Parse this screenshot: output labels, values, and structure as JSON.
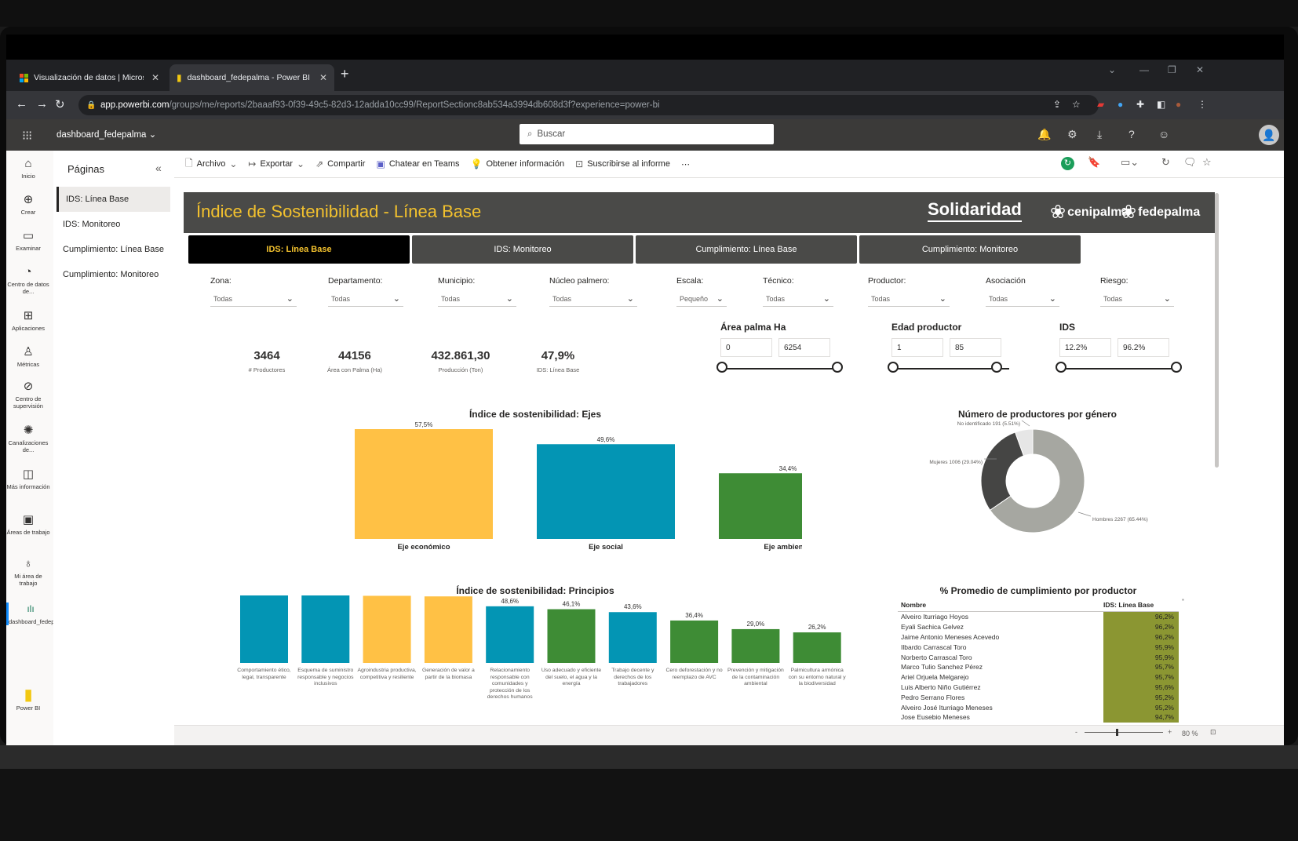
{
  "browser": {
    "tabs": [
      {
        "label": "Visualización de datos | Microsof"
      },
      {
        "label": "dashboard_fedepalma - Power BI"
      }
    ],
    "url_domain": "app.powerbi.com",
    "url_path": "/groups/me/reports/2baaaf93-0f39-49c5-82d3-12adda10cc99/ReportSectionc8ab534a3994db608d3f?experience=power-bi"
  },
  "powerbi": {
    "workspace": "dashboard_fedepalma",
    "search_placeholder": "Buscar",
    "rail": [
      {
        "label": "Inicio",
        "icon": "home-icon",
        "glyph": "⌂"
      },
      {
        "label": "Crear",
        "icon": "create-icon",
        "glyph": "⊕"
      },
      {
        "label": "Examinar",
        "icon": "folder-icon",
        "glyph": "▭"
      },
      {
        "label": "Centro de datos de...",
        "icon": "data-hub-icon",
        "glyph": "◔"
      },
      {
        "label": "Aplicaciones",
        "icon": "apps-icon",
        "glyph": "⊞"
      },
      {
        "label": "Métricas",
        "icon": "trophy-icon",
        "glyph": "♙"
      },
      {
        "label": "Centro de supervisión",
        "icon": "monitor-icon",
        "glyph": "⊘"
      },
      {
        "label": "Canalizaciones de...",
        "icon": "pipeline-icon",
        "glyph": "✺"
      },
      {
        "label": "Más información",
        "icon": "book-icon",
        "glyph": "◫"
      },
      {
        "label": "Áreas de trabajo",
        "icon": "workspaces-icon",
        "glyph": "▣"
      },
      {
        "label": "Mi área de trabajo",
        "icon": "user-icon",
        "glyph": "♁"
      },
      {
        "label": "dashboard_fedepalma",
        "icon": "report-icon",
        "glyph": "ılı"
      }
    ],
    "rail_bottom": "Power BI",
    "pages_title": "Páginas",
    "pages": [
      "IDS: Línea Base",
      "IDS: Monitoreo",
      "Cumplimiento: Línea Base",
      "Cumplimiento: Monitoreo"
    ],
    "toolbar": [
      "Archivo",
      "Exportar",
      "Compartir",
      "Chatear en Teams",
      "Obtener información",
      "Suscribirse al informe"
    ],
    "zoom": "80 %"
  },
  "report": {
    "title": "Índice de Sostenibilidad - Línea Base",
    "logos": [
      "Solidaridad",
      "cenipalma",
      "fedepalma"
    ],
    "nav_tabs": [
      "IDS: Línea Base",
      "IDS: Monitoreo",
      "Cumplimiento: Línea Base",
      "Cumplimiento: Monitoreo"
    ],
    "slicers": [
      {
        "label": "Zona:",
        "value": "Todas"
      },
      {
        "label": "Departamento:",
        "value": "Todas"
      },
      {
        "label": "Municipio:",
        "value": "Todas"
      },
      {
        "label": "Núcleo palmero:",
        "value": "Todas"
      },
      {
        "label": "Escala:",
        "value": "Pequeño"
      },
      {
        "label": "Técnico:",
        "value": "Todas"
      },
      {
        "label": "Productor:",
        "value": "Todas"
      },
      {
        "label": "Asociación",
        "value": "Todas"
      },
      {
        "label": "Riesgo:",
        "value": "Todas"
      }
    ],
    "kpis": [
      {
        "value": "3464",
        "label": "# Productores"
      },
      {
        "value": "44156",
        "label": "Área con Palma (Ha)"
      },
      {
        "value": "432.861,30",
        "label": "Producción (Ton)"
      },
      {
        "value": "47,9%",
        "label": "IDS: Línea Base"
      }
    ],
    "range_slicers": [
      {
        "title": "Área palma Ha",
        "min": "0",
        "max": "6254"
      },
      {
        "title": "Edad productor",
        "min": "1",
        "max": "85"
      },
      {
        "title": "IDS",
        "min": "12.2%",
        "max": "96.2%"
      }
    ],
    "table": {
      "title": "% Promedio de cumplimiento por productor",
      "col_name": "Nombre",
      "col_value": "IDS: Línea Base",
      "rows": [
        [
          "Alveiro Iturriago Hoyos",
          "96,2%"
        ],
        [
          "Eyali Sachica Gelvez",
          "96,2%"
        ],
        [
          "Jaime Antonio Meneses Acevedo",
          "96,2%"
        ],
        [
          "Ilbardo Carrascal Toro",
          "95,9%"
        ],
        [
          "Norberto Carrascal Toro",
          "95,9%"
        ],
        [
          "Marco Tulio Sanchez Pérez",
          "95,7%"
        ],
        [
          "Ariel Orjuela Melgarejo",
          "95,7%"
        ],
        [
          "Luis Alberto Niño Gutiérrez",
          "95,6%"
        ],
        [
          "Pedro Serrano Flores",
          "95,2%"
        ],
        [
          "Alveiro José Iturriago Meneses",
          "95,2%"
        ],
        [
          "Jose Eusebio Meneses",
          "94,7%"
        ]
      ]
    }
  },
  "colors": {
    "yellow": "#FFC145",
    "teal": "#0395B4",
    "green": "#3E8C35",
    "donut_dark": "#454544",
    "donut_light": "#A6A7A1",
    "donut_white": "#E6E6E6"
  },
  "chart_data": [
    {
      "type": "bar",
      "title": "Índice de sostenibilidad: Ejes",
      "categories": [
        "Eje económico",
        "Eje social",
        "Eje ambiental"
      ],
      "values": [
        57.5,
        49.6,
        34.4
      ],
      "labels": [
        "57,5%",
        "49,6%",
        "34,4%"
      ],
      "colors": [
        "#FFC145",
        "#0395B4",
        "#3E8C35"
      ],
      "ylim": [
        0,
        60
      ]
    },
    {
      "type": "pie",
      "title": "Número de productores por género",
      "slices": [
        {
          "name": "Hombres",
          "value": 2267,
          "label": "Hombres 2267 (65.44%)",
          "color": "#A6A7A1"
        },
        {
          "name": "Mujeres",
          "value": 1006,
          "label": "Mujeres 1006 (29.04%)",
          "color": "#454544"
        },
        {
          "name": "No identificado",
          "value": 191,
          "label": "No identificado 191 (5.51%)",
          "color": "#E6E6E6"
        }
      ]
    },
    {
      "type": "bar",
      "title": "Índice de sostenibilidad: Principios",
      "categories": [
        "Comportamiento ético, legal, transparente",
        "Esquema de suministro responsable y negocios inclusivos",
        "Agroindustria productiva, competitiva y resiliente",
        "Generación de valor a partir de la biomasa",
        "Relacionamiento responsable con comunidades y protección de los derechos humanos",
        "Uso adecuado y eficiente del suelo, el agua y la energía",
        "Trabajo decente y derechos de los trabajadores",
        "Cero deforestación y no reemplazo de AVC",
        "Prevención y mitigación de la contaminación ambiental",
        "Palmicultura armónica con su entorno natural y la biodiversidad"
      ],
      "values": [
        60.6,
        60.5,
        57.6,
        57.1,
        48.6,
        46.1,
        43.6,
        36.4,
        29.0,
        26.2
      ],
      "labels": [
        "60,6%",
        "60,5%",
        "57,6%",
        "57,1%",
        "48,6%",
        "46,1%",
        "43,6%",
        "36,4%",
        "29,0%",
        "26,2%"
      ],
      "colors": [
        "#0395B4",
        "#0395B4",
        "#FFC145",
        "#FFC145",
        "#0395B4",
        "#3E8C35",
        "#0395B4",
        "#3E8C35",
        "#3E8C35",
        "#3E8C35"
      ],
      "ylim": [
        0,
        62
      ]
    }
  ]
}
